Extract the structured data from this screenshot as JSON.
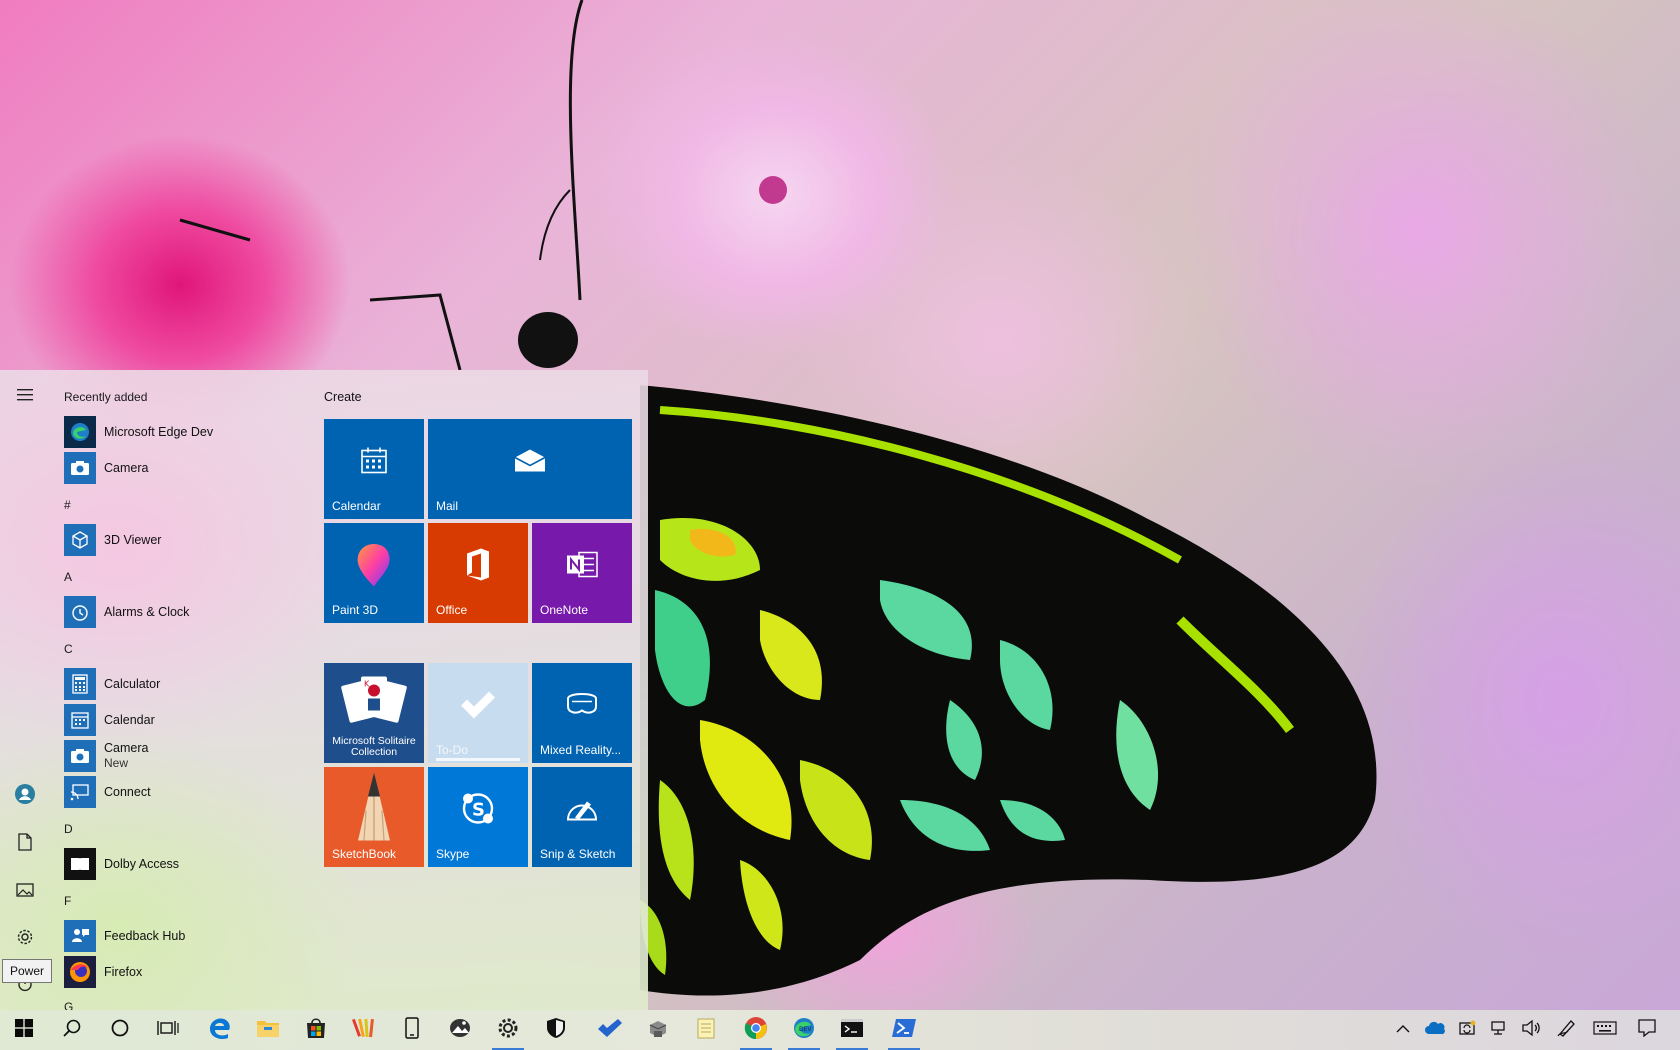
{
  "start_menu": {
    "rail": {
      "hamburger_icon": "hamburger-icon",
      "items": [
        "user-icon",
        "documents-icon",
        "pictures-icon",
        "settings-icon",
        "power-icon"
      ]
    },
    "groups": [
      {
        "header": "Recently added",
        "apps": [
          {
            "name": "Microsoft Edge Dev",
            "icon": "edge-dev-icon"
          },
          {
            "name": "Camera",
            "icon": "camera-icon"
          }
        ]
      },
      {
        "header": "#",
        "apps": [
          {
            "name": "3D Viewer",
            "icon": "3d-viewer-icon"
          }
        ]
      },
      {
        "header": "A",
        "apps": [
          {
            "name": "Alarms & Clock",
            "icon": "alarm-clock-icon"
          }
        ]
      },
      {
        "header": "C",
        "apps": [
          {
            "name": "Calculator",
            "icon": "calculator-icon"
          },
          {
            "name": "Calendar",
            "icon": "calendar-icon"
          },
          {
            "name": "Camera",
            "sub": "New",
            "icon": "camera-icon"
          },
          {
            "name": "Connect",
            "icon": "connect-icon"
          }
        ]
      },
      {
        "header": "D",
        "apps": [
          {
            "name": "Dolby Access",
            "icon": "dolby-icon"
          }
        ]
      },
      {
        "header": "F",
        "apps": [
          {
            "name": "Feedback Hub",
            "icon": "feedback-hub-icon"
          },
          {
            "name": "Firefox",
            "icon": "firefox-icon"
          }
        ]
      },
      {
        "header": "G",
        "apps": []
      }
    ],
    "tiles_header": "Create",
    "tiles": [
      {
        "label": "Calendar",
        "color": "#0063b1",
        "icon": "calendar-icon"
      },
      {
        "label": "Mail",
        "color": "#0063b1",
        "icon": "mail-icon"
      },
      {
        "label": "Paint 3D",
        "color": "#0063b1",
        "icon": "paint3d-icon"
      },
      {
        "label": "Office",
        "color": "#d83b01",
        "icon": "office-icon"
      },
      {
        "label": "OneNote",
        "color": "#7719aa",
        "icon": "onenote-icon"
      },
      {
        "label": "Microsoft Solitaire Collection",
        "color": "#1f4e8c",
        "icon": "solitaire-cards-icon"
      },
      {
        "label": "To-Do",
        "color": "#c7dcef",
        "icon": "todo-check-icon"
      },
      {
        "label": "Mixed Reality...",
        "color": "#0063b1",
        "icon": "mixed-reality-icon"
      },
      {
        "label": "SketchBook",
        "color": "#e85a2a",
        "icon": "sketchbook-pencil-icon"
      },
      {
        "label": "Skype",
        "color": "#0078d7",
        "icon": "skype-icon"
      },
      {
        "label": "Snip & Sketch",
        "color": "#0063b1",
        "icon": "snip-sketch-icon"
      }
    ]
  },
  "tooltip": {
    "text": "Power"
  },
  "taskbar": {
    "left_buttons": [
      "start-icon",
      "search-icon",
      "cortana-icon",
      "task-view-icon"
    ],
    "pinned_apps": [
      "edge-icon",
      "file-explorer-icon",
      "store-icon",
      "paint-swatches-icon",
      "phone-icon",
      "photos-icon",
      "settings-icon",
      "security-shield-icon",
      "todo-icon",
      "3d-builder-icon",
      "notepad-icon",
      "chrome-icon",
      "edge-dev-icon",
      "terminal-icon",
      "powershell-icon"
    ],
    "tray": [
      "chevron-up-icon",
      "onedrive-icon",
      "sync-icon",
      "network-icon",
      "volume-icon",
      "pen-icon",
      "keyboard-icon",
      "notification-icon"
    ]
  }
}
